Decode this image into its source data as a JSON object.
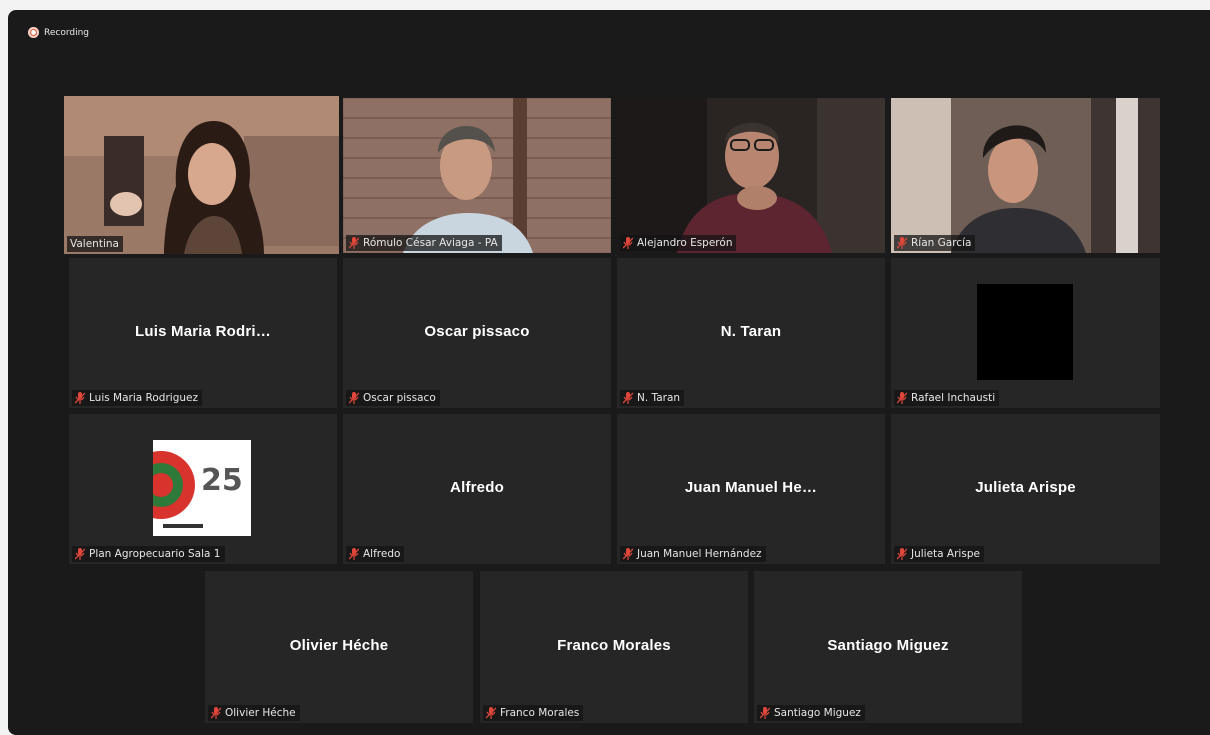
{
  "recording": {
    "label": "Recording",
    "color": "#e8532e"
  },
  "accent": {
    "active_speaker_border": "#c9e36a",
    "muted_mic": "#e0473a"
  },
  "participants": [
    {
      "name": "Valentina",
      "muted": false,
      "video": true,
      "active": true
    },
    {
      "name": "Rómulo César Aviaga - PA",
      "muted": true,
      "video": true
    },
    {
      "name": "Alejandro Esperón",
      "muted": true,
      "video": true
    },
    {
      "name": "Rían García",
      "muted": true,
      "video": true
    },
    {
      "name": "Luis Maria Rodriguez",
      "display": "Luis  Maria  Rodri…",
      "muted": true,
      "video": false
    },
    {
      "name": "Oscar pissaco",
      "display": "Oscar pissaco",
      "muted": true,
      "video": false
    },
    {
      "name": "N. Taran",
      "display": "N. Taran",
      "muted": true,
      "video": false
    },
    {
      "name": "Rafael Inchausti",
      "muted": true,
      "video": false,
      "avatar": "black"
    },
    {
      "name": "Plan Agropecuario Sala 1",
      "muted": true,
      "video": false,
      "avatar": "logo",
      "logo_text": "25"
    },
    {
      "name": "Alfredo",
      "display": "Alfredo",
      "muted": true,
      "video": false
    },
    {
      "name": "Juan Manuel Hernández",
      "display": "Juan  Manuel  He…",
      "muted": true,
      "video": false
    },
    {
      "name": "Julieta Arispe",
      "display": "Julieta Arispe",
      "muted": true,
      "video": false
    },
    {
      "name": "Olivier Héche",
      "display": "Olivier Héche",
      "muted": true,
      "video": false
    },
    {
      "name": "Franco Morales",
      "display": "Franco Morales",
      "muted": true,
      "video": false
    },
    {
      "name": "Santiago Miguez",
      "display": "Santiago Miguez",
      "muted": true,
      "video": false
    }
  ]
}
